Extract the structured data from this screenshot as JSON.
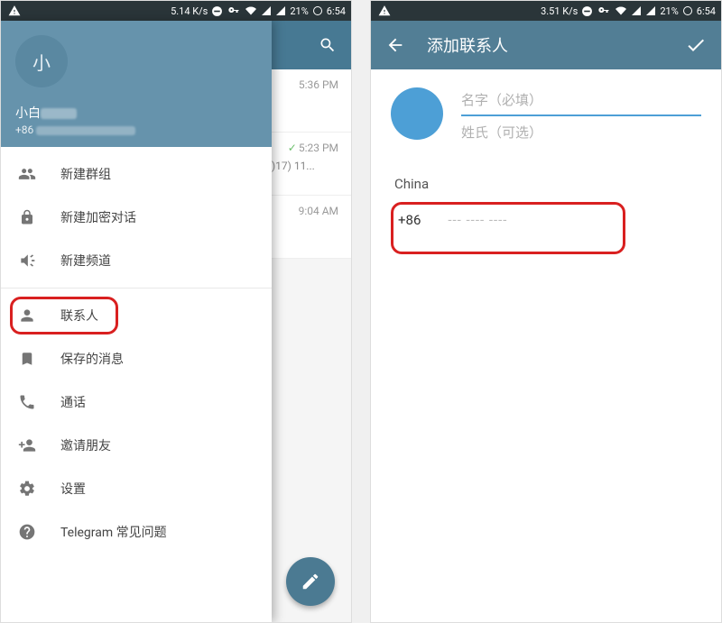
{
  "status": {
    "speed1": "5.14 K/s",
    "speed2": "3.51 K/s",
    "battery": "21%",
    "time": "6:54"
  },
  "phone1": {
    "drawer": {
      "avatar_initial": "小",
      "name_prefix": "小白",
      "phone_prefix": "+86",
      "items": [
        {
          "label": "新建群组"
        },
        {
          "label": "新建加密对话"
        },
        {
          "label": "新建频道"
        },
        {
          "label": "联系人"
        },
        {
          "label": "保存的消息"
        },
        {
          "label": "通话"
        },
        {
          "label": "邀请朋友"
        },
        {
          "label": "设置"
        },
        {
          "label": "Telegram 常见问题"
        }
      ]
    },
    "chatlist": [
      {
        "time": "5:36 PM",
        "sub": ""
      },
      {
        "time": "5:23 PM",
        "sub": ")17) 11..."
      },
      {
        "time": "9:04 AM",
        "sub": ""
      }
    ]
  },
  "phone2": {
    "title": "添加联系人",
    "first_name_placeholder": "名字（必填）",
    "last_name_placeholder": "姓氏（可选）",
    "country": "China",
    "country_code": "+86",
    "phone_placeholder": "--- ---- ----"
  }
}
